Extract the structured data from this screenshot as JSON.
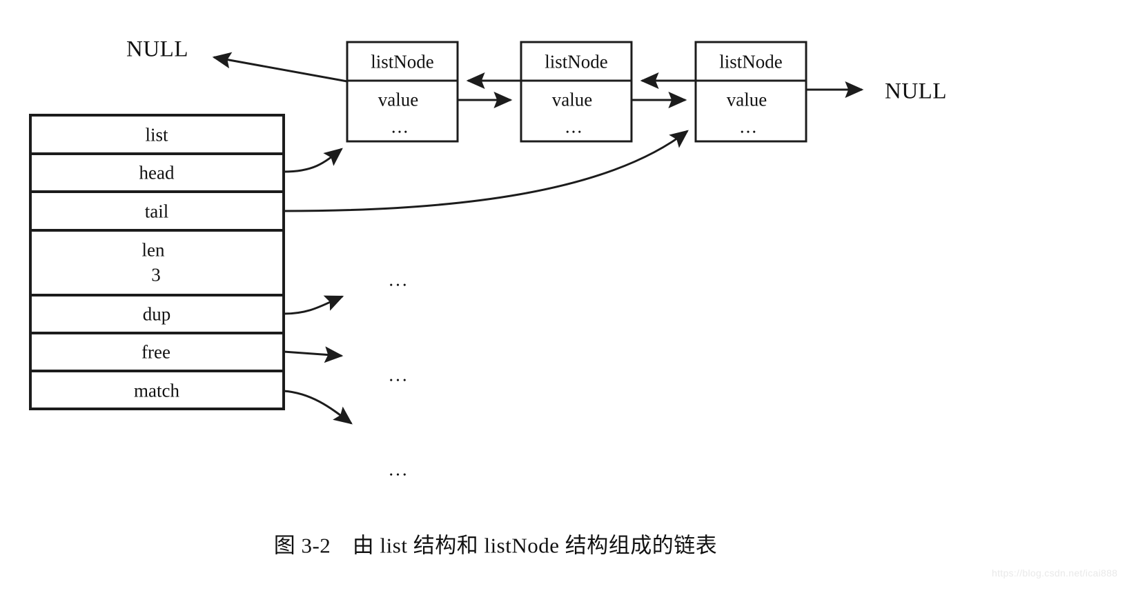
{
  "figure": {
    "caption": "图 3-2　由 list 结构和 listNode 结构组成的链表",
    "watermark": "https://blog.csdn.net/icai888",
    "null_left": "NULL",
    "null_right": "NULL"
  },
  "list_struct": {
    "title": "list",
    "fields": [
      {
        "name": "head",
        "value": ""
      },
      {
        "name": "tail",
        "value": ""
      },
      {
        "name": "len",
        "value": "3"
      },
      {
        "name": "dup",
        "value": ""
      },
      {
        "name": "free",
        "value": ""
      },
      {
        "name": "match",
        "value": ""
      }
    ]
  },
  "nodes": [
    {
      "title": "listNode",
      "value": "value",
      "more": "..."
    },
    {
      "title": "listNode",
      "value": "value",
      "more": "..."
    },
    {
      "title": "listNode",
      "value": "value",
      "more": "..."
    }
  ],
  "callback_targets": [
    {
      "label": "..."
    },
    {
      "label": "..."
    },
    {
      "label": "..."
    }
  ],
  "colors": {
    "stroke": "#1c1c1c",
    "background": "#ffffff",
    "text": "#111111",
    "watermark": "#e9e9e9"
  }
}
